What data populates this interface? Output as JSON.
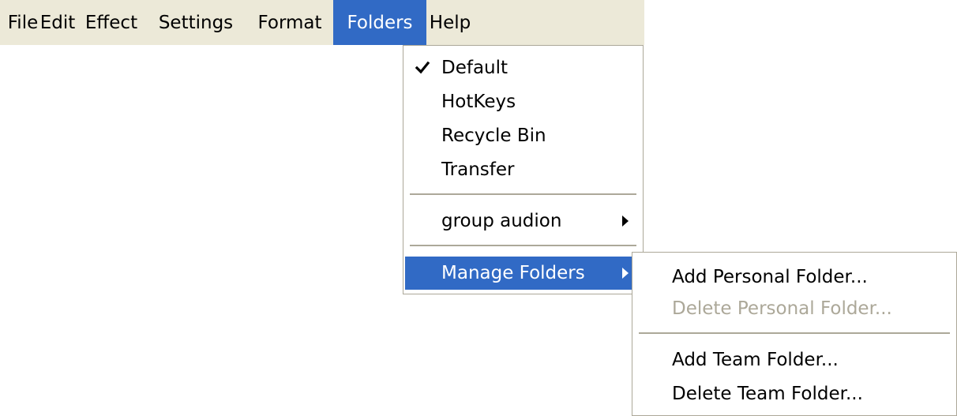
{
  "menubar": {
    "items": [
      {
        "label": "File",
        "active": false
      },
      {
        "label": "Edit",
        "active": false
      },
      {
        "label": "Effect",
        "active": false
      },
      {
        "label": "Settings",
        "active": false
      },
      {
        "label": "Format",
        "active": false
      },
      {
        "label": "Folders",
        "active": true
      },
      {
        "label": "Help",
        "active": false
      }
    ]
  },
  "folders_menu": {
    "items": [
      {
        "label": "Default",
        "checked": true
      },
      {
        "label": "HotKeys",
        "checked": false
      },
      {
        "label": "Recycle Bin",
        "checked": false
      },
      {
        "label": "Transfer",
        "checked": false
      }
    ],
    "group_audion": {
      "label": "group audion",
      "has_submenu": true
    },
    "manage_folders": {
      "label": "Manage Folders",
      "has_submenu": true,
      "highlighted": true
    }
  },
  "manage_submenu": {
    "add_personal": {
      "label": "Add Personal Folder...",
      "enabled": true
    },
    "delete_personal": {
      "label": "Delete Personal Folder...",
      "enabled": false
    },
    "add_team": {
      "label": "Add Team Folder...",
      "enabled": true
    },
    "delete_team": {
      "label": "Delete Team Folder...",
      "enabled": true
    }
  },
  "colors": {
    "menubar_bg": "#ece9d8",
    "highlight": "#316ac5",
    "disabled_text": "#aca899",
    "border": "#aca899"
  }
}
